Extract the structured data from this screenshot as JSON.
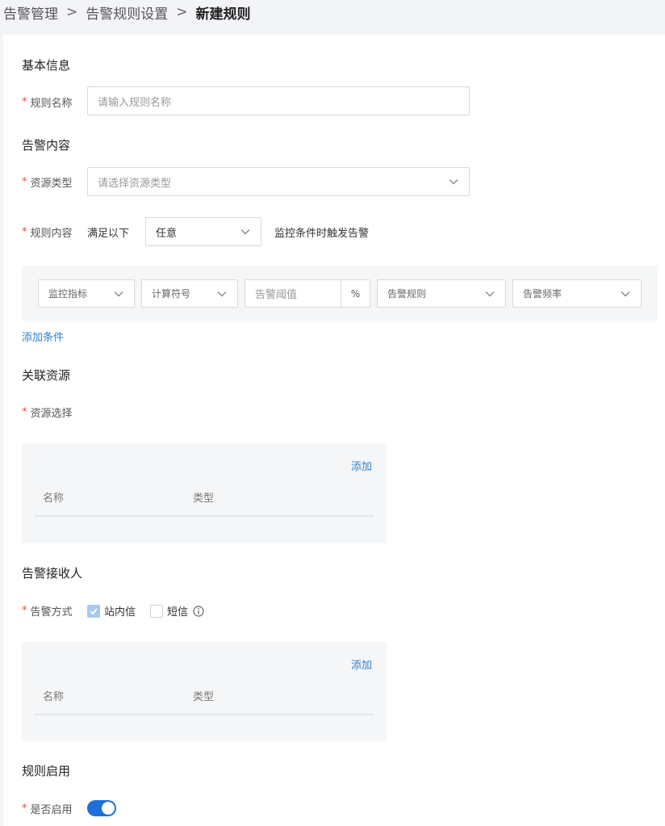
{
  "breadcrumb": {
    "items": [
      "告警管理",
      "告警规则设置"
    ],
    "separator": ">",
    "current": "新建规则"
  },
  "basic_info": {
    "title": "基本信息",
    "rule_name": {
      "label": "规则名称",
      "placeholder": "请输入规则名称"
    }
  },
  "alert_content": {
    "title": "告警内容",
    "resource_type": {
      "label": "资源类型",
      "placeholder": "请选择资源类型"
    },
    "rule_content": {
      "label": "规则内容",
      "prefix": "满足以下",
      "match_value": "任意",
      "suffix": "监控条件时触发告警"
    },
    "condition": {
      "metric": "监控指标",
      "operator": "计算符号",
      "threshold_placeholder": "告警阈值",
      "unit": "%",
      "rule": "告警规则",
      "frequency": "告警频率"
    },
    "add_condition": "添加条件"
  },
  "related_resources": {
    "title": "关联资源",
    "select_label": "资源选择",
    "add_label": "添加",
    "columns": [
      "名称",
      "类型"
    ]
  },
  "recipients": {
    "title": "告警接收人",
    "method_label": "告警方式",
    "methods": [
      {
        "label": "站内信",
        "checked": true
      },
      {
        "label": "短信",
        "checked": false
      }
    ],
    "add_label": "添加",
    "columns": [
      "名称",
      "类型"
    ]
  },
  "enable": {
    "title": "规则启用",
    "label": "是否启用",
    "enabled": true
  },
  "colors": {
    "accent": "#1e6fd9",
    "link": "#2d7fd1",
    "required": "#e74c3c",
    "page_bg": "#f2f4f7"
  }
}
